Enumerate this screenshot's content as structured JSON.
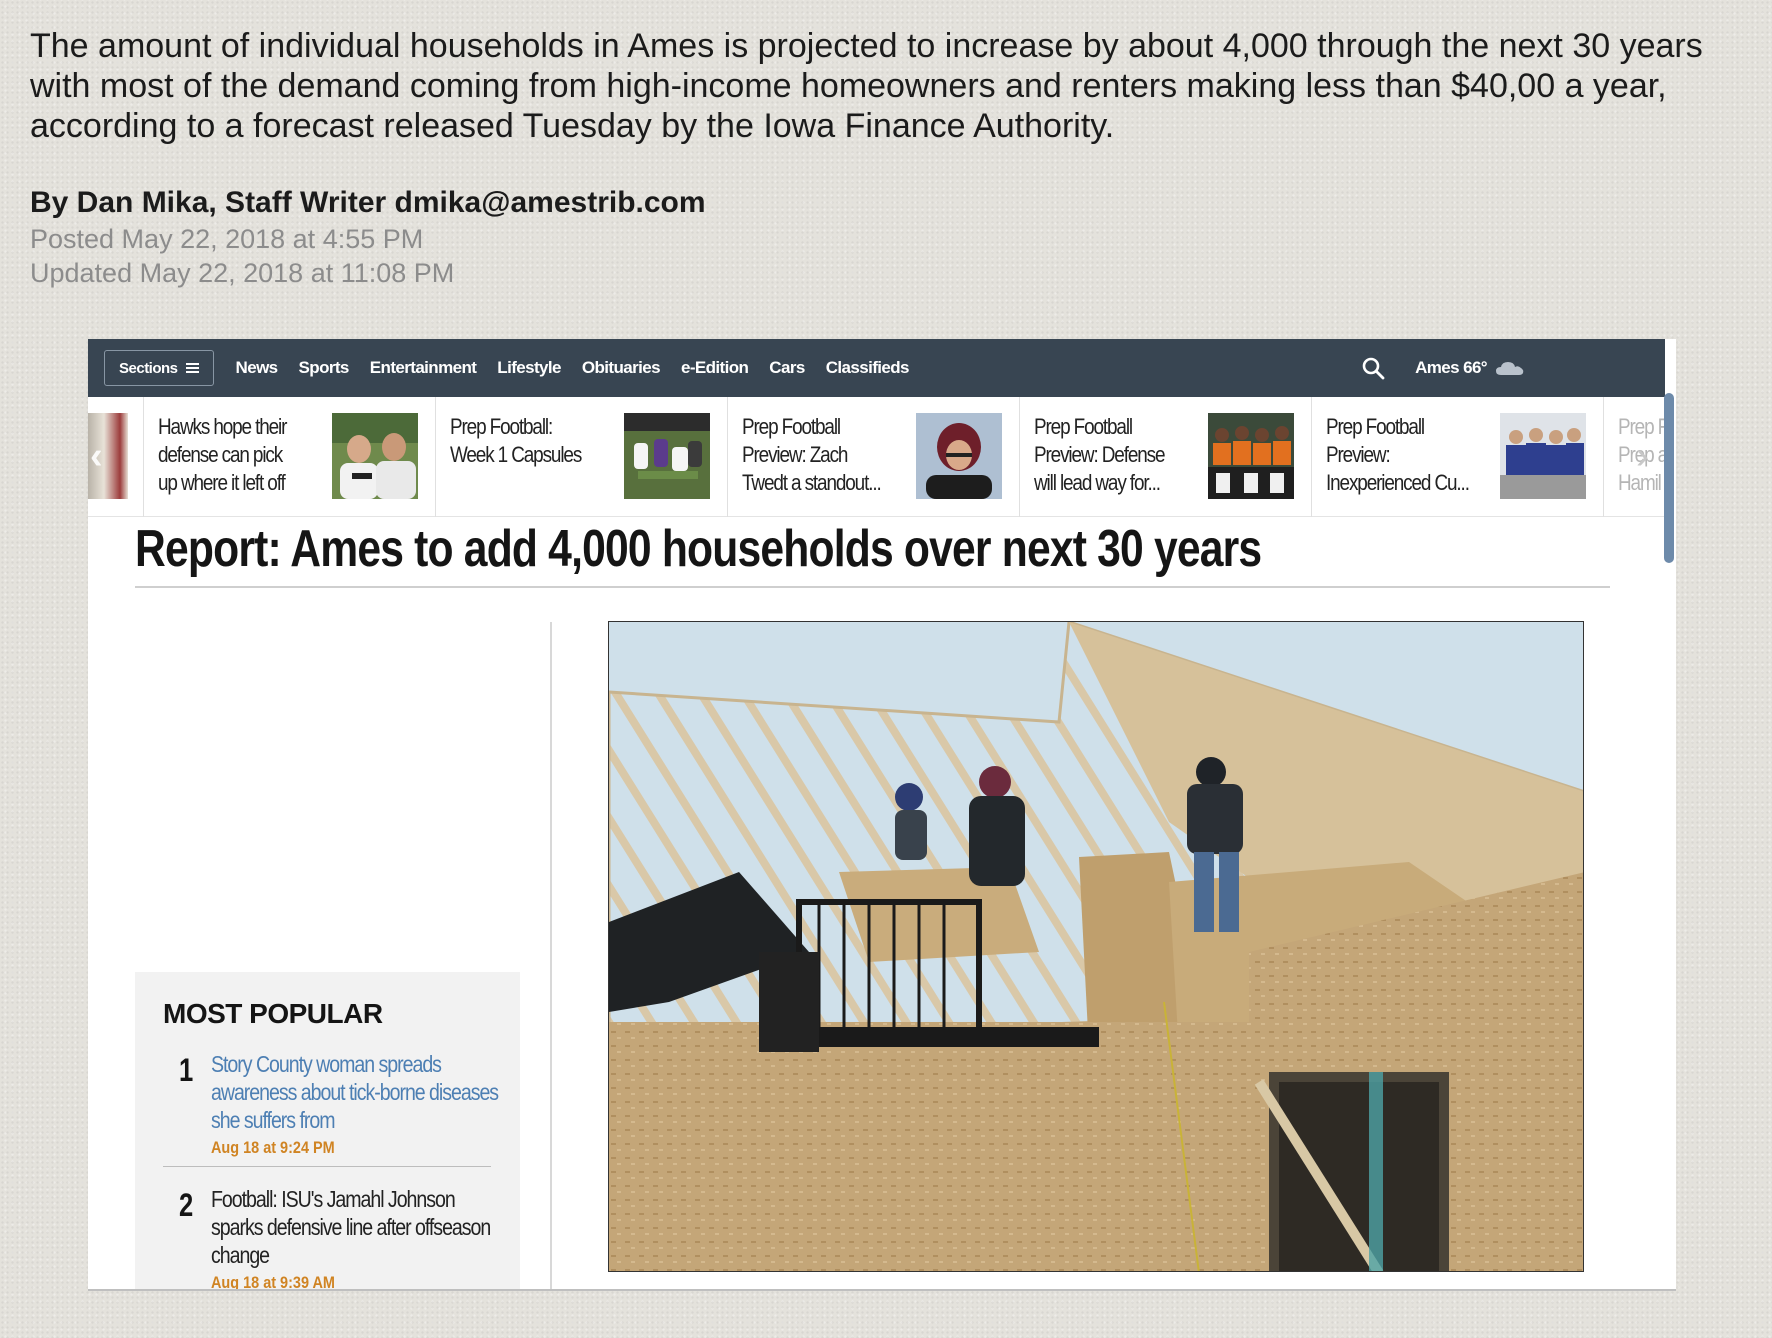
{
  "article": {
    "intro": "The amount of individual households in Ames is projected to increase by about 4,000 through the next 30 years with most of the demand coming from high-income homeowners and renters making less than $40,00 a year, according to a forecast released Tuesday by the Iowa Finance Authority.",
    "byline": "By Dan Mika, Staff Writer dmika@amestrib.com",
    "posted": "Posted May 22, 2018 at 4:55 PM",
    "updated": "Updated May 22, 2018 at 11:08 PM"
  },
  "screenshot": {
    "nav": {
      "sections_label": "Sections",
      "links": [
        "News",
        "Sports",
        "Entertainment",
        "Lifestyle",
        "Obituaries",
        "e-Edition",
        "Cars",
        "Classifieds"
      ],
      "weather": "Ames 66°"
    },
    "ticker": [
      {
        "text": "Hawks hope their defense can pick up where it left off"
      },
      {
        "text": "Prep Football: Week 1 Capsules"
      },
      {
        "text": "Prep Football Preview: Zach Twedt a standout..."
      },
      {
        "text": "Prep Football Preview: Defense will lead way for..."
      },
      {
        "text": "Prep Football Preview: Inexperienced Cu..."
      },
      {
        "text": "Prep F Prep a Hamil"
      }
    ],
    "headline": "Report: Ames to add 4,000 households over next 30 years",
    "most_popular": {
      "title": "MOST POPULAR",
      "items": [
        {
          "num": "1",
          "text": "Story County woman spreads awareness about tick-borne diseases she suffers from",
          "time": "Aug 18 at 9:24 PM"
        },
        {
          "num": "2",
          "text": "Football: ISU's Jamahl Johnson sparks defensive line after offseason change",
          "time": "Aug 18 at 9:39 AM"
        }
      ]
    },
    "colors": {
      "nav_bg": "#384552",
      "link_blue": "#4d7fb3",
      "time_orange": "#d08423"
    }
  }
}
